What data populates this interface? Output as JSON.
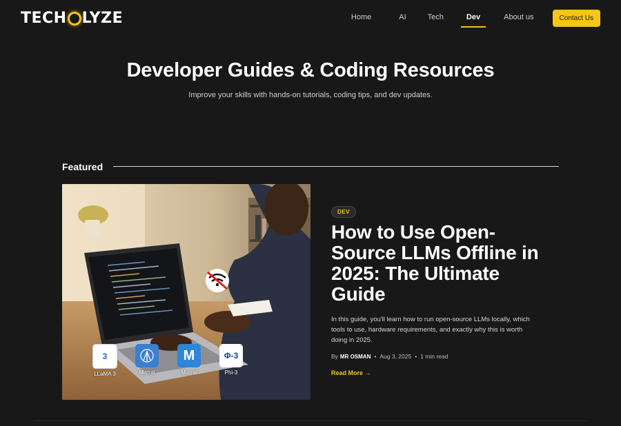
{
  "header": {
    "logo_left": "TECH",
    "logo_right": "LYZE",
    "nav": [
      {
        "label": "Home"
      },
      {
        "label": "AI"
      },
      {
        "label": "Tech"
      },
      {
        "label": "Dev",
        "active": true
      },
      {
        "label": "About us"
      }
    ],
    "contact_label": "Contact Us"
  },
  "hero": {
    "title": "Developer Guides & Coding Resources",
    "subtitle": "Improve your skills with hands-on tutorials, coding tips, and dev updates."
  },
  "featured": {
    "section_label": "Featured",
    "image": {
      "llm_badges": [
        {
          "label": "LLaMA 3",
          "icon": "llama-icon",
          "glyph": "3"
        },
        {
          "label": "Mistral",
          "icon": "mistral-tower-icon",
          "glyph": ""
        },
        {
          "label": "Mistral",
          "icon": "mistral-m-icon",
          "glyph": "M"
        },
        {
          "label": "Phi-3",
          "icon": "phi-icon",
          "glyph": "Φ-3"
        }
      ]
    },
    "article": {
      "tag": "DEV",
      "title": "How to Use Open-Source LLMs Offline in 2025: The Ultimate Guide",
      "excerpt": "In this guide, you'll learn how to run open-source LLMs locally, which tools to use, hardware requirements, and exactly why this is worth doing in 2025.",
      "by_label": "By",
      "author": "MR OSMAN",
      "date": "Aug 3, 2025",
      "read_time": "1 min read",
      "read_more": "Read More →"
    }
  },
  "colors": {
    "background": "#181818",
    "accent": "#f5c518",
    "text": "#ffffff"
  }
}
